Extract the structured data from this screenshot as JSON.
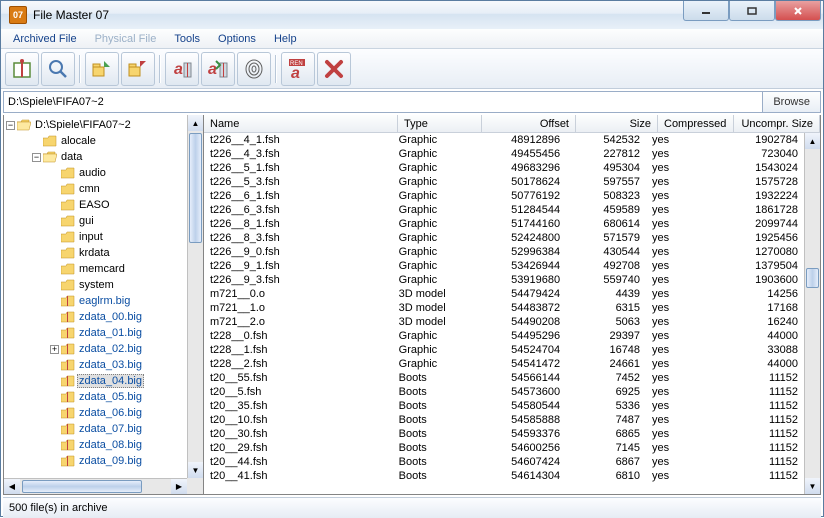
{
  "window": {
    "title": "File Master 07"
  },
  "menu": {
    "archived": "Archived File",
    "physical": "Physical File",
    "tools": "Tools",
    "options": "Options",
    "help": "Help"
  },
  "path": {
    "value": "D:\\Spiele\\FIFA07~2",
    "browse": "Browse"
  },
  "tree": {
    "root": "D:\\Spiele\\FIFA07~2",
    "nodes": [
      {
        "indent": 1,
        "exp": "",
        "icon": "closed",
        "label": "alocale"
      },
      {
        "indent": 1,
        "exp": "-",
        "icon": "open",
        "label": "data"
      },
      {
        "indent": 2,
        "exp": "",
        "icon": "closed",
        "label": "audio"
      },
      {
        "indent": 2,
        "exp": "",
        "icon": "closed",
        "label": "cmn"
      },
      {
        "indent": 2,
        "exp": "",
        "icon": "closed",
        "label": "EASO"
      },
      {
        "indent": 2,
        "exp": "",
        "icon": "closed",
        "label": "gui"
      },
      {
        "indent": 2,
        "exp": "",
        "icon": "closed",
        "label": "input"
      },
      {
        "indent": 2,
        "exp": "",
        "icon": "closed",
        "label": "krdata"
      },
      {
        "indent": 2,
        "exp": "",
        "icon": "closed",
        "label": "memcard"
      },
      {
        "indent": 2,
        "exp": "",
        "icon": "closed",
        "label": "system"
      },
      {
        "indent": 2,
        "exp": "",
        "icon": "file",
        "label": "eaglrm.big",
        "blue": true
      },
      {
        "indent": 2,
        "exp": "",
        "icon": "file",
        "label": "zdata_00.big",
        "blue": true
      },
      {
        "indent": 2,
        "exp": "",
        "icon": "file",
        "label": "zdata_01.big",
        "blue": true
      },
      {
        "indent": 2,
        "exp": "+",
        "icon": "file",
        "label": "zdata_02.big",
        "blue": true
      },
      {
        "indent": 2,
        "exp": "",
        "icon": "file",
        "label": "zdata_03.big",
        "blue": true
      },
      {
        "indent": 2,
        "exp": "",
        "icon": "file",
        "label": "zdata_04.big",
        "blue": true,
        "selected": true
      },
      {
        "indent": 2,
        "exp": "",
        "icon": "file",
        "label": "zdata_05.big",
        "blue": true
      },
      {
        "indent": 2,
        "exp": "",
        "icon": "file",
        "label": "zdata_06.big",
        "blue": true
      },
      {
        "indent": 2,
        "exp": "",
        "icon": "file",
        "label": "zdata_07.big",
        "blue": true
      },
      {
        "indent": 2,
        "exp": "",
        "icon": "file",
        "label": "zdata_08.big",
        "blue": true
      },
      {
        "indent": 2,
        "exp": "",
        "icon": "file",
        "label": "zdata_09.big",
        "blue": true
      }
    ]
  },
  "list": {
    "columns": {
      "name": "Name",
      "type": "Type",
      "offset": "Offset",
      "size": "Size",
      "compressed": "Compressed",
      "uncomp": "Uncompr. Size"
    },
    "rows": [
      {
        "name": "t226__4_1.fsh",
        "type": "Graphic",
        "offset": "48912896",
        "size": "542532",
        "comp": "yes",
        "uncomp": "1902784"
      },
      {
        "name": "t226__4_3.fsh",
        "type": "Graphic",
        "offset": "49455456",
        "size": "227812",
        "comp": "yes",
        "uncomp": "723040"
      },
      {
        "name": "t226__5_1.fsh",
        "type": "Graphic",
        "offset": "49683296",
        "size": "495304",
        "comp": "yes",
        "uncomp": "1543024"
      },
      {
        "name": "t226__5_3.fsh",
        "type": "Graphic",
        "offset": "50178624",
        "size": "597557",
        "comp": "yes",
        "uncomp": "1575728"
      },
      {
        "name": "t226__6_1.fsh",
        "type": "Graphic",
        "offset": "50776192",
        "size": "508323",
        "comp": "yes",
        "uncomp": "1932224"
      },
      {
        "name": "t226__6_3.fsh",
        "type": "Graphic",
        "offset": "51284544",
        "size": "459589",
        "comp": "yes",
        "uncomp": "1861728"
      },
      {
        "name": "t226__8_1.fsh",
        "type": "Graphic",
        "offset": "51744160",
        "size": "680614",
        "comp": "yes",
        "uncomp": "2099744"
      },
      {
        "name": "t226__8_3.fsh",
        "type": "Graphic",
        "offset": "52424800",
        "size": "571579",
        "comp": "yes",
        "uncomp": "1925456"
      },
      {
        "name": "t226__9_0.fsh",
        "type": "Graphic",
        "offset": "52996384",
        "size": "430544",
        "comp": "yes",
        "uncomp": "1270080"
      },
      {
        "name": "t226__9_1.fsh",
        "type": "Graphic",
        "offset": "53426944",
        "size": "492708",
        "comp": "yes",
        "uncomp": "1379504"
      },
      {
        "name": "t226__9_3.fsh",
        "type": "Graphic",
        "offset": "53919680",
        "size": "559740",
        "comp": "yes",
        "uncomp": "1903600"
      },
      {
        "name": "m721__0.o",
        "type": "3D model",
        "offset": "54479424",
        "size": "4439",
        "comp": "yes",
        "uncomp": "14256"
      },
      {
        "name": "m721__1.o",
        "type": "3D model",
        "offset": "54483872",
        "size": "6315",
        "comp": "yes",
        "uncomp": "17168"
      },
      {
        "name": "m721__2.o",
        "type": "3D model",
        "offset": "54490208",
        "size": "5063",
        "comp": "yes",
        "uncomp": "16240"
      },
      {
        "name": "t228__0.fsh",
        "type": "Graphic",
        "offset": "54495296",
        "size": "29397",
        "comp": "yes",
        "uncomp": "44000"
      },
      {
        "name": "t228__1.fsh",
        "type": "Graphic",
        "offset": "54524704",
        "size": "16748",
        "comp": "yes",
        "uncomp": "33088"
      },
      {
        "name": "t228__2.fsh",
        "type": "Graphic",
        "offset": "54541472",
        "size": "24661",
        "comp": "yes",
        "uncomp": "44000"
      },
      {
        "name": "t20__55.fsh",
        "type": "Boots",
        "offset": "54566144",
        "size": "7452",
        "comp": "yes",
        "uncomp": "11152"
      },
      {
        "name": "t20__5.fsh",
        "type": "Boots",
        "offset": "54573600",
        "size": "6925",
        "comp": "yes",
        "uncomp": "11152"
      },
      {
        "name": "t20__35.fsh",
        "type": "Boots",
        "offset": "54580544",
        "size": "5336",
        "comp": "yes",
        "uncomp": "11152"
      },
      {
        "name": "t20__10.fsh",
        "type": "Boots",
        "offset": "54585888",
        "size": "7487",
        "comp": "yes",
        "uncomp": "11152"
      },
      {
        "name": "t20__30.fsh",
        "type": "Boots",
        "offset": "54593376",
        "size": "6865",
        "comp": "yes",
        "uncomp": "11152"
      },
      {
        "name": "t20__29.fsh",
        "type": "Boots",
        "offset": "54600256",
        "size": "7145",
        "comp": "yes",
        "uncomp": "11152"
      },
      {
        "name": "t20__44.fsh",
        "type": "Boots",
        "offset": "54607424",
        "size": "6867",
        "comp": "yes",
        "uncomp": "11152"
      },
      {
        "name": "t20__41.fsh",
        "type": "Boots",
        "offset": "54614304",
        "size": "6810",
        "comp": "yes",
        "uncomp": "11152"
      }
    ]
  },
  "status": {
    "text": "500 file(s) in archive"
  }
}
